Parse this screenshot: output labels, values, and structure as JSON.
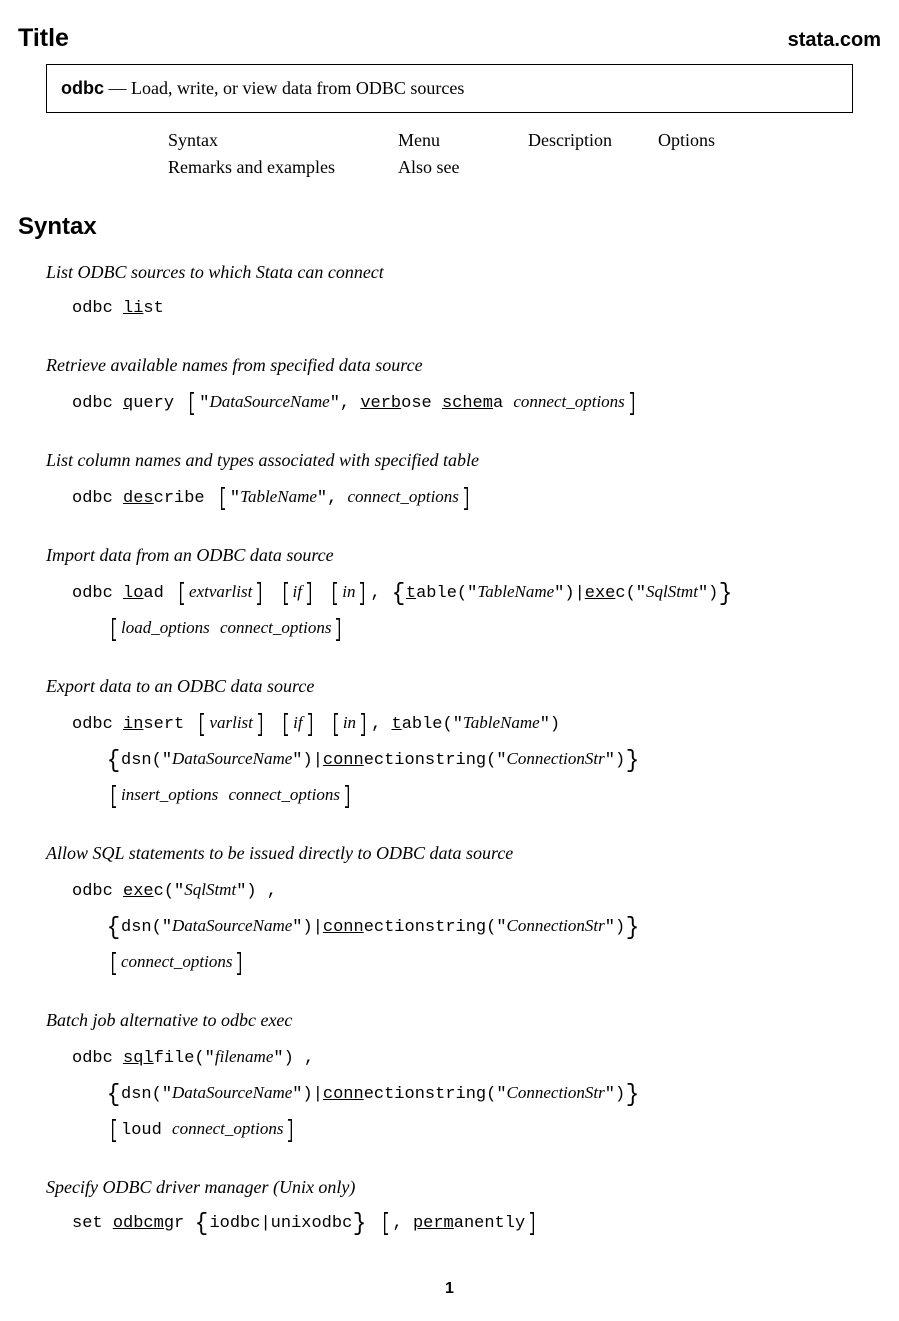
{
  "header": {
    "title": "Title",
    "site": "stata.com"
  },
  "titlebox": {
    "cmd": "odbc",
    "sep": "—",
    "desc": "Load, write, or view data from ODBC sources"
  },
  "toc": {
    "r1": {
      "c1": "Syntax",
      "c2": "Menu",
      "c3": "Description",
      "c4": "Options"
    },
    "r2": {
      "c1": "Remarks and examples",
      "c2": "Also see"
    }
  },
  "syntax": {
    "heading": "Syntax",
    "s1": {
      "desc": "List ODBC sources to which Stata can connect",
      "tt1": "odbc ",
      "u1": "li",
      "tt2": "st"
    },
    "s2": {
      "desc": "Retrieve available names from specified data source",
      "tt1": "odbc ",
      "u1": "q",
      "tt2": "uery ",
      "it1": "DataSourceName",
      "tt3": ", ",
      "u2": "verb",
      "tt4": "ose ",
      "u3": "schem",
      "tt5": "a ",
      "it2": "connect_options"
    },
    "s3": {
      "desc": "List column names and types associated with specified table",
      "tt1": "odbc ",
      "u1": "des",
      "tt2": "cribe ",
      "it1": "TableName",
      "tt3": ", ",
      "it2": "connect_options"
    },
    "s4": {
      "desc": "Import data from an ODBC data source",
      "tt1": "odbc ",
      "u1": "lo",
      "tt2": "ad ",
      "it1": "extvarlist",
      "it2": "if",
      "it3": "in",
      "tt3": ", ",
      "u2": "t",
      "tt4": "able(\"",
      "it4": "TableName",
      "tt5": "\")",
      "u3": "exe",
      "tt6": "c(\"",
      "it5": "SqlStmt",
      "tt7": "\")",
      "it6": "load_options",
      "it7": "connect_options"
    },
    "s5": {
      "desc": "Export data to an ODBC data source",
      "tt1": "odbc ",
      "u1": "in",
      "tt2": "sert ",
      "it1": "varlist",
      "it2": "if",
      "it3": "in",
      "tt3": ", ",
      "u2": "t",
      "tt4": "able(\"",
      "it4": "TableName",
      "tt5": "\")",
      "tt6": "dsn(\"",
      "it5": "DataSourceName",
      "tt7": "\")",
      "u3": "conn",
      "tt8": "ectionstring(\"",
      "it6": "ConnectionStr",
      "tt9": "\")",
      "it7": "insert_options",
      "it8": "connect_options"
    },
    "s6": {
      "desc": "Allow SQL statements to be issued directly to ODBC data source",
      "tt1": "odbc ",
      "u1": "exe",
      "tt2": "c(\"",
      "it1": "SqlStmt",
      "tt3": "\") ,",
      "tt4": "dsn(\"",
      "it2": "DataSourceName",
      "tt5": "\")",
      "u2": "conn",
      "tt6": "ectionstring(\"",
      "it3": "ConnectionStr",
      "tt7": "\")",
      "it4": "connect_options"
    },
    "s7": {
      "desc": "Batch job alternative to odbc exec",
      "tt1": "odbc ",
      "u1": "sql",
      "tt2": "file(\"",
      "it1": "filename",
      "tt3": "\") ,",
      "tt4": "dsn(\"",
      "it2": "DataSourceName",
      "tt5": "\")",
      "u2": "conn",
      "tt6": "ectionstring(\"",
      "it3": "ConnectionStr",
      "tt7": "\")",
      "tt8": "loud ",
      "it4": "connect_options"
    },
    "s8": {
      "desc": "Specify ODBC driver manager (Unix only)",
      "tt1": "set ",
      "u1": "odbcmg",
      "tt2": "r ",
      "tt3": "iodbc",
      "tt4": "unixodbc",
      "tt5": ", ",
      "u2": "perm",
      "tt6": "anently"
    }
  },
  "pagenum": "1"
}
